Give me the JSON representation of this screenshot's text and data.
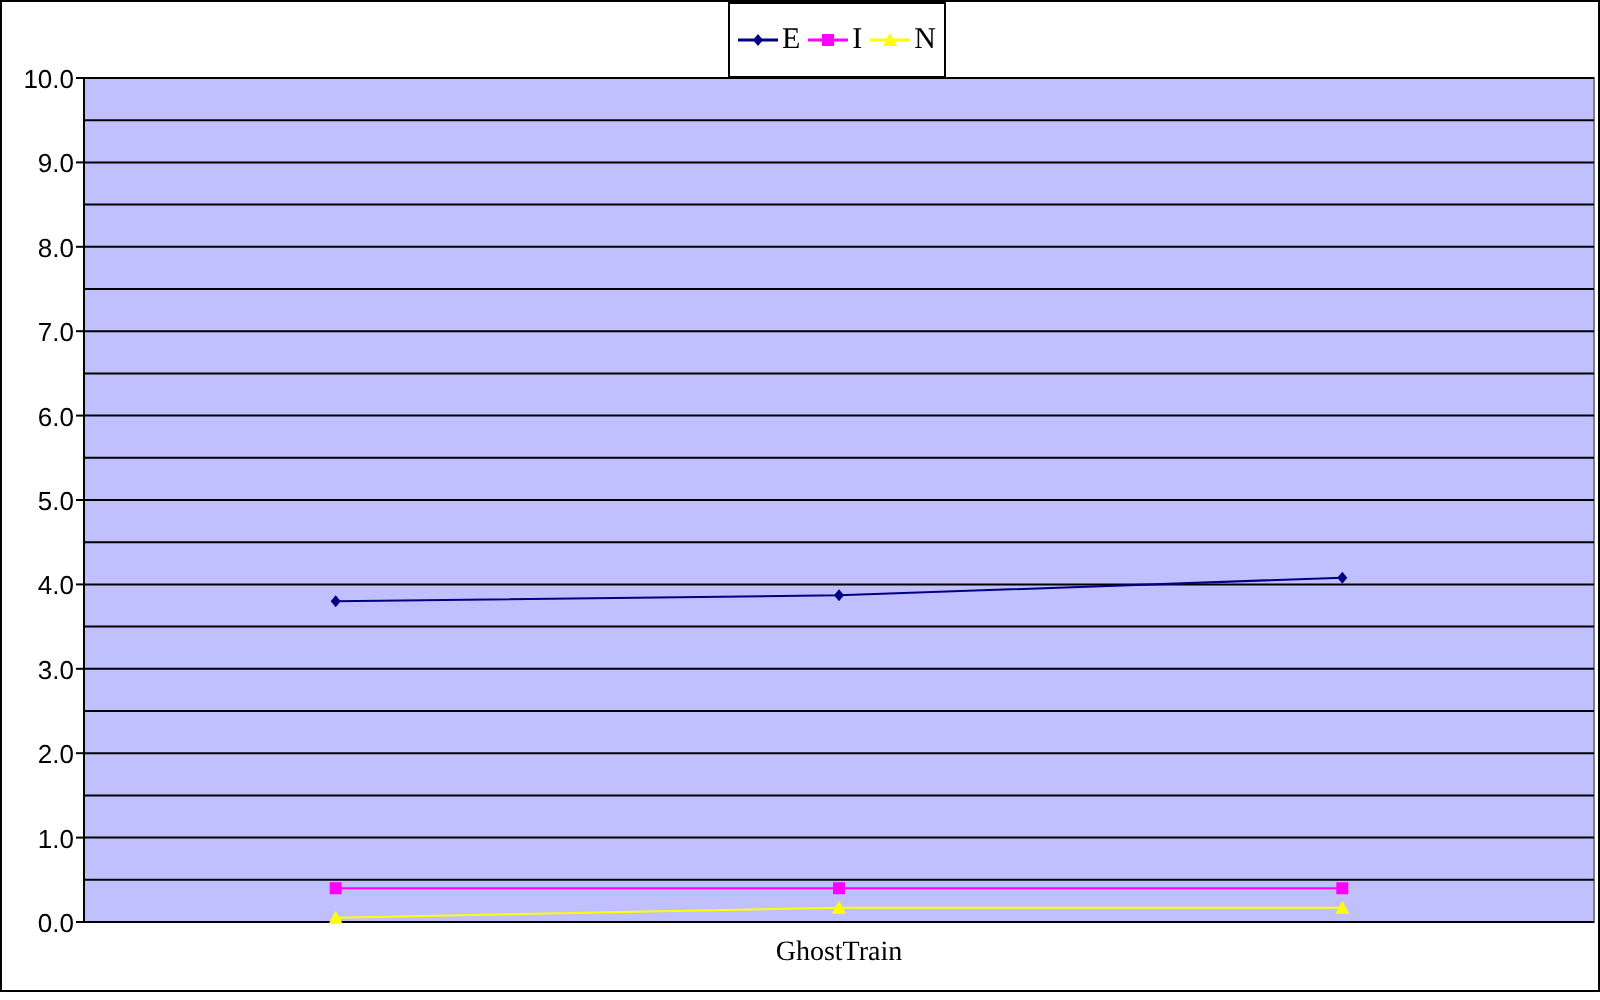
{
  "chart_data": {
    "type": "line",
    "series": [
      {
        "name": "E",
        "color": "#000080",
        "marker": "diamond",
        "values": [
          3.8,
          3.87,
          4.08
        ]
      },
      {
        "name": "I",
        "color": "#ff00ff",
        "marker": "square",
        "values": [
          0.4,
          0.4,
          0.4
        ]
      },
      {
        "name": "N",
        "color": "#ffff00",
        "marker": "triangle",
        "values": [
          0.05,
          0.17,
          0.17
        ]
      }
    ],
    "ylim": [
      0,
      10
    ],
    "grid": "y",
    "legend": "top",
    "annotations": [
      "GhostTrain"
    ],
    "yticks": [
      {
        "value": 0,
        "label": "0.0"
      },
      {
        "value": 1,
        "label": "1.0"
      },
      {
        "value": 2,
        "label": "2.0"
      },
      {
        "value": 3,
        "label": "3.0"
      },
      {
        "value": 4,
        "label": "4.0"
      },
      {
        "value": 5,
        "label": "5.0"
      },
      {
        "value": 6,
        "label": "6.0"
      },
      {
        "value": 7,
        "label": "7.0"
      },
      {
        "value": 8,
        "label": "8.0"
      },
      {
        "value": 9,
        "label": "9.0"
      },
      {
        "value": 10,
        "label": "10.0"
      }
    ]
  }
}
